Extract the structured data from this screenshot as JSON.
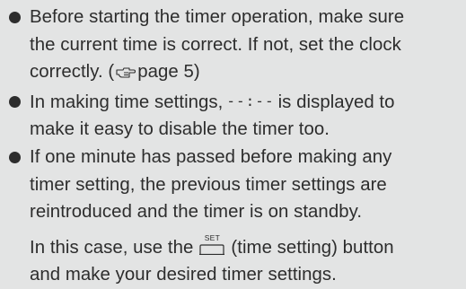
{
  "bullets": [
    {
      "lines": [
        "Before starting the timer operation, make sure",
        "the current time is correct. If not, set the clock",
        "correctly. ("
      ],
      "page_ref": "page 5",
      "tail": ")"
    },
    {
      "line1_before": "In making time settings,",
      "line1_display": "--:--",
      "line1_after": "is displayed to",
      "line2": "make it easy to disable the timer too."
    },
    {
      "lines": [
        "If one minute has passed before making any",
        "timer setting, the previous timer settings are",
        "reintroduced and the timer is on standby."
      ],
      "follow_up": {
        "before": "In this case, use the",
        "key_label": "SET",
        "after": "(time setting) button",
        "line2": "and make your desired timer settings."
      }
    }
  ],
  "icons": {
    "page_reference": "pointing-hand-icon",
    "bullet": "bullet-dot-icon",
    "set_key": "set-button-icon"
  }
}
